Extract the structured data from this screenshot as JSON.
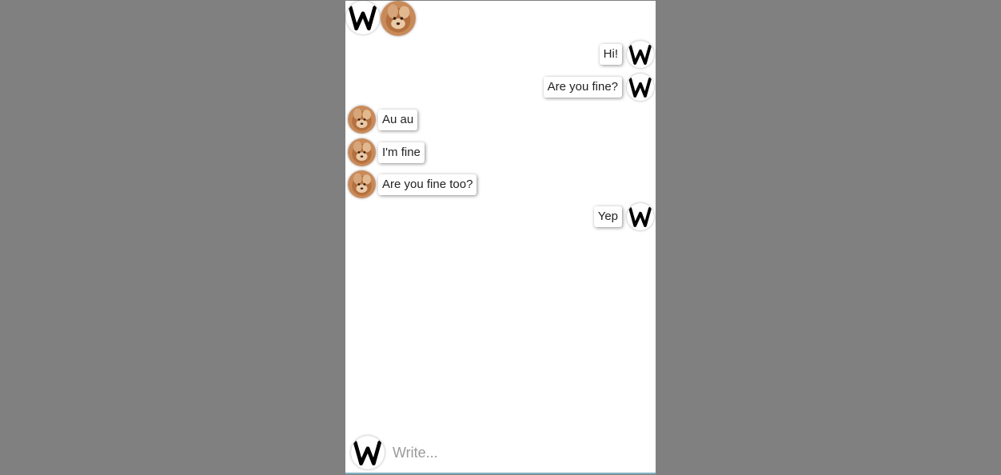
{
  "header": {
    "user_avatar_icon": "w-letter-icon",
    "contact_avatar_icon": "puppy-photo-icon"
  },
  "messages": [
    {
      "side": "right",
      "text": "Hi!",
      "avatar": "w-letter-icon"
    },
    {
      "side": "right",
      "text": "Are you fine?",
      "avatar": "w-letter-icon"
    },
    {
      "side": "left",
      "text": "Au au",
      "avatar": "puppy-photo-icon"
    },
    {
      "side": "left",
      "text": "I'm fine",
      "avatar": "puppy-photo-icon"
    },
    {
      "side": "left",
      "text": "Are you fine too?",
      "avatar": "puppy-photo-icon"
    },
    {
      "side": "right",
      "text": "Yep",
      "avatar": "w-letter-icon"
    }
  ],
  "composer": {
    "placeholder": "Write...",
    "value": "",
    "avatar": "w-letter-icon"
  },
  "colors": {
    "backdrop": "#808080",
    "panel": "#ffffff",
    "bubble_text": "#222222"
  }
}
